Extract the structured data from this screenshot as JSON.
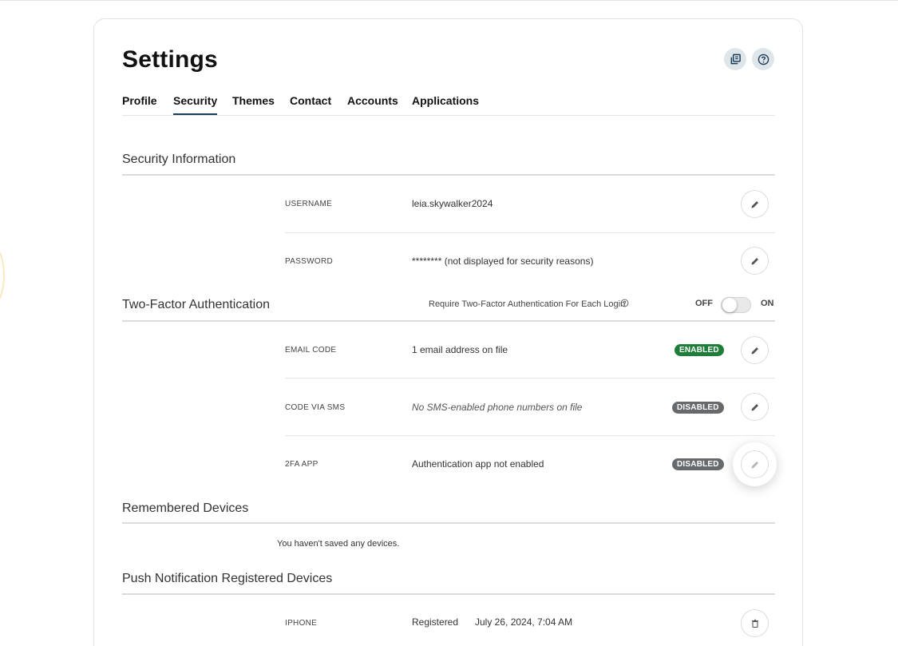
{
  "page": {
    "title": "Settings"
  },
  "header": {
    "icons": [
      "copy-icon",
      "help-icon"
    ]
  },
  "tabs": [
    {
      "label": "Profile",
      "active": false
    },
    {
      "label": "Security",
      "active": true
    },
    {
      "label": "Themes",
      "active": false
    },
    {
      "label": "Contact",
      "active": false
    },
    {
      "label": "Accounts",
      "active": false
    },
    {
      "label": "Applications",
      "active": false
    }
  ],
  "security_info": {
    "title": "Security Information",
    "rows": [
      {
        "label": "USERNAME",
        "value": "leia.skywalker2024"
      },
      {
        "label": "PASSWORD",
        "value": "******** (not displayed for security reasons)"
      }
    ]
  },
  "two_factor": {
    "title": "Two-Factor Authentication",
    "require_label": "Require Two-Factor Authentication For Each Login",
    "toggle_off_label": "OFF",
    "toggle_on_label": "ON",
    "toggle_state": "off",
    "rows": [
      {
        "label": "EMAIL CODE",
        "value": "1 email address on file",
        "status": "ENABLED"
      },
      {
        "label": "CODE VIA SMS",
        "value": "No SMS-enabled phone numbers on file",
        "status": "DISABLED"
      },
      {
        "label": "2FA APP",
        "value": "Authentication app not enabled",
        "status": "DISABLED"
      }
    ]
  },
  "remembered_devices": {
    "title": "Remembered Devices",
    "empty_text": "You haven't saved any devices."
  },
  "push_devices": {
    "title": "Push Notification Registered Devices",
    "rows": [
      {
        "label": "IPHONE",
        "status": "Registered",
        "date": "July 26, 2024, 7:04 AM"
      }
    ]
  },
  "colors": {
    "enabled": "#1e7d38",
    "disabled": "#666a6d",
    "active_tab": "#1c3d5a"
  }
}
